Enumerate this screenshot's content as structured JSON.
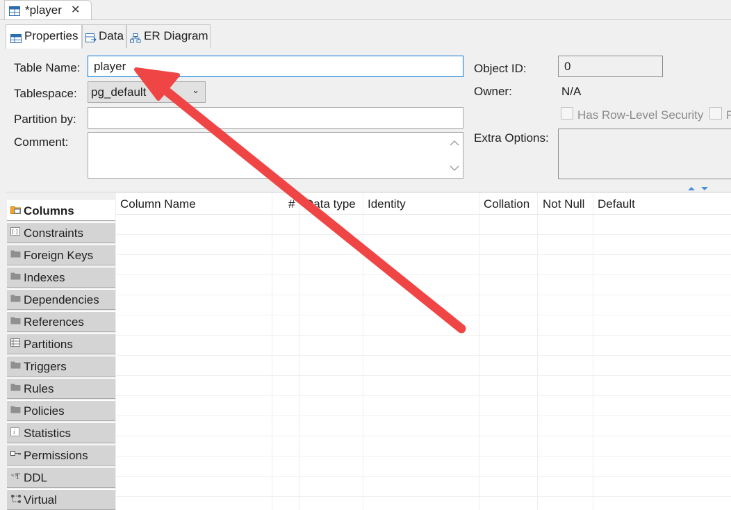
{
  "editor_tab": {
    "title": "*player",
    "icon": "table-icon",
    "close_icon": "close-icon"
  },
  "subtabs": [
    {
      "label": "Properties",
      "icon": "properties-icon",
      "active": true
    },
    {
      "label": "Data",
      "icon": "data-icon",
      "active": false
    },
    {
      "label": "ER Diagram",
      "icon": "er-diagram-icon",
      "active": false
    }
  ],
  "form": {
    "table_name_label": "Table Name:",
    "table_name_value": "player",
    "tablespace_label": "Tablespace:",
    "tablespace_value": "pg_default",
    "partition_label": "Partition by:",
    "partition_value": "",
    "comment_label": "Comment:",
    "comment_value": "",
    "object_id_label": "Object ID:",
    "object_id_value": "0",
    "owner_label": "Owner:",
    "owner_value": "N/A",
    "rls_label": "Has Row-Level Security",
    "extra_options_label": "Extra Options:",
    "extra_options_value": ""
  },
  "categories": [
    {
      "label": "Columns",
      "icon": "columns-folder-icon",
      "active": true
    },
    {
      "label": "Constraints",
      "icon": "constraints-icon",
      "active": false
    },
    {
      "label": "Foreign Keys",
      "icon": "folder-icon",
      "active": false
    },
    {
      "label": "Indexes",
      "icon": "folder-icon",
      "active": false
    },
    {
      "label": "Dependencies",
      "icon": "folder-icon",
      "active": false
    },
    {
      "label": "References",
      "icon": "folder-icon",
      "active": false
    },
    {
      "label": "Partitions",
      "icon": "partitions-icon",
      "active": false
    },
    {
      "label": "Triggers",
      "icon": "folder-icon",
      "active": false
    },
    {
      "label": "Rules",
      "icon": "folder-icon",
      "active": false
    },
    {
      "label": "Policies",
      "icon": "folder-icon",
      "active": false
    },
    {
      "label": "Statistics",
      "icon": "statistics-icon",
      "active": false
    },
    {
      "label": "Permissions",
      "icon": "key-icon",
      "active": false
    },
    {
      "label": "DDL",
      "icon": "ddl-icon",
      "active": false
    },
    {
      "label": "Virtual",
      "icon": "virtual-icon",
      "active": false
    }
  ],
  "columns_table": {
    "headers": [
      "Column Name",
      "#",
      "Data type",
      "Identity",
      "Collation",
      "Not Null",
      "Default"
    ]
  },
  "annotation": {
    "type": "arrow",
    "color": "#f04040"
  }
}
